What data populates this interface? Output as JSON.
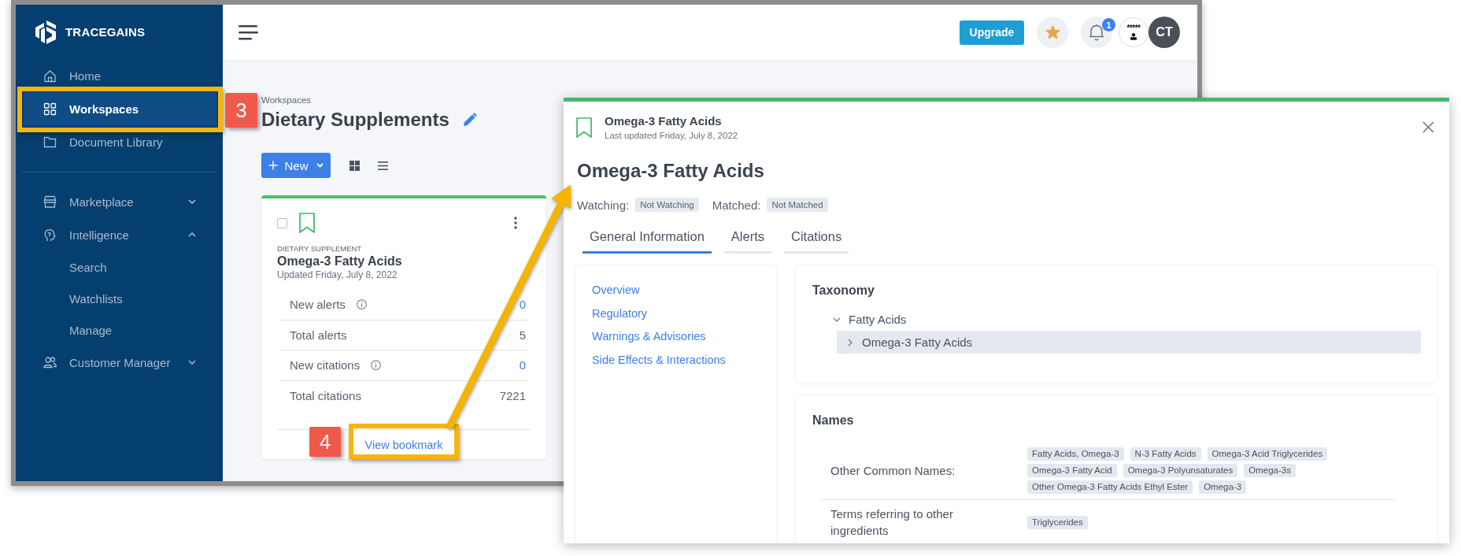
{
  "sidebar": {
    "logo": "TRACEGAINS",
    "sections": [
      {
        "items": [
          {
            "label": "Home",
            "selected": false
          },
          {
            "label": "Workspaces",
            "selected": true
          },
          {
            "label": "Document Library",
            "selected": false
          }
        ]
      },
      {
        "items": [
          {
            "label": "Marketplace",
            "selected": false,
            "expanded": false
          },
          {
            "label": "Intelligence",
            "selected": false,
            "expanded": true,
            "children": [
              {
                "label": "Search",
                "selected": false
              },
              {
                "label": "Watchlists",
                "selected": false
              },
              {
                "label": "Manage",
                "selected": false
              }
            ]
          },
          {
            "label": "Customer Manager",
            "selected": false,
            "expanded": false
          }
        ]
      }
    ]
  },
  "topbar": {
    "upgrade": "Upgrade",
    "notification_count": "1",
    "avatars": [
      {
        "kind": "image",
        "label": "*****"
      },
      {
        "kind": "initials",
        "label": "CT"
      }
    ]
  },
  "workspace": {
    "breadcrumb": "Workspaces",
    "title": "Dietary Supplements",
    "new_button": "New",
    "card": {
      "checked": false,
      "type": "DIETARY SUPPLEMENT",
      "title": "Omega-3 Fatty Acids",
      "updated": "Updated Friday, July 8, 2022",
      "stats": [
        {
          "label": "New alerts",
          "info": true,
          "value": "0",
          "link": true
        },
        {
          "label": "Total alerts",
          "info": false,
          "value": "5",
          "link": false
        },
        {
          "label": "New citations",
          "info": true,
          "value": "0",
          "link": true
        },
        {
          "label": "Total citations",
          "info": false,
          "value": "7221",
          "link": false
        }
      ],
      "link": "View bookmark"
    }
  },
  "detail_panel": {
    "header_title": "Omega-3 Fatty Acids",
    "header_subtitle": "Last updated Friday, July 8, 2022",
    "title": "Omega-3 Fatty Acids",
    "status": [
      {
        "label": "Watching:",
        "value": "Not Watching"
      },
      {
        "label": "Matched:",
        "value": "Not Matched"
      }
    ],
    "tabs": [
      {
        "label": "General Information",
        "selected": true
      },
      {
        "label": "Alerts",
        "selected": false
      },
      {
        "label": "Citations",
        "selected": false
      }
    ],
    "section_links": [
      "Overview",
      "Regulatory",
      "Warnings & Advisories",
      "Side Effects & Interactions"
    ],
    "taxonomy": {
      "title": "Taxonomy",
      "tree": [
        {
          "label": "Fatty Acids",
          "expanded": true,
          "selected": false,
          "children": [
            {
              "label": "Omega-3 Fatty Acids",
              "expanded": false,
              "selected": true
            }
          ]
        }
      ]
    },
    "names": {
      "title": "Names",
      "rows": [
        {
          "label": "Other Common Names:",
          "tags": [
            "Fatty Acids, Omega-3",
            "N-3 Fatty Acids",
            "Omega-3 Acid Triglycerides",
            "Omega-3 Fatty Acid",
            "Omega-3 Polyunsaturates",
            "Omega-3s",
            "Other Omega-3 Fatty Acids Ethyl Ester",
            "Omega-3"
          ]
        },
        {
          "label": "Terms referring to other ingredients",
          "tags": [
            "Triglycerides"
          ]
        }
      ]
    }
  },
  "annotations": {
    "callouts": [
      "3",
      "4"
    ]
  }
}
